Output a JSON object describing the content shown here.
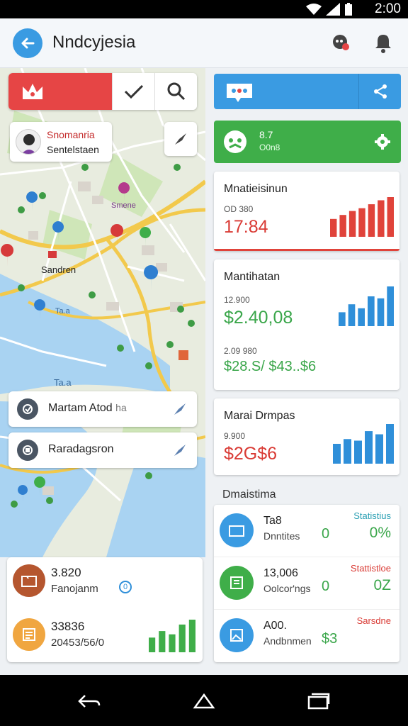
{
  "status_bar": {
    "time": "2:00"
  },
  "app_bar": {
    "title": "Nndcyjesia"
  },
  "map": {
    "place_card": {
      "title": "Snomanria",
      "subtitle": "Sentelstaen"
    },
    "labels": [
      "Sandren",
      "Ta.a"
    ],
    "poi_label": "Smene",
    "routes": [
      {
        "label": "Martam Atod",
        "suffix": "ha"
      },
      {
        "label": "Raradagsron",
        "suffix": ""
      }
    ]
  },
  "bottom_card": {
    "rows": [
      {
        "value": "3.820",
        "sub": "Fanojanm",
        "badge": "0",
        "icon": "folder-icon",
        "color": "#b5562f"
      },
      {
        "value": "33836",
        "sub": "20453/56/0",
        "badge": "",
        "icon": "note-icon",
        "color": "#f0a640"
      }
    ]
  },
  "right": {
    "green_card": {
      "line1": "8.7",
      "line2": "O0n8"
    },
    "stat_cards": [
      {
        "title": "Mnatieisinun",
        "small": "OD 380",
        "big": "17:84",
        "big_color": "#d93a34",
        "bar_color": "#e0433a",
        "bars": [
          0.45,
          0.55,
          0.65,
          0.72,
          0.82,
          0.92,
          1.0
        ]
      },
      {
        "title": "Mantihatan",
        "small": "12.900",
        "big": "$2.40,08",
        "big_color": "#3aa64a",
        "small2": "2.09 980",
        "big2": "$28.S/ $43..$6",
        "bar_color": "#2f8fd9",
        "bars": [
          0.35,
          0.55,
          0.45,
          0.75,
          0.7,
          1.0
        ]
      },
      {
        "title": "Marai Drmpas",
        "small": "9.900",
        "big": "$2G$6",
        "big_color": "#d93a34",
        "bar_color": "#2f8fd9",
        "bars": [
          0.5,
          0.62,
          0.58,
          0.82,
          0.74,
          1.0
        ]
      }
    ],
    "section_label": "Dmaistima",
    "list": [
      {
        "value": "Ta8",
        "sub": "Dnntites",
        "n1": "0",
        "tag": "Statistius",
        "n2": "0%",
        "tag_color": "#2a9fb3",
        "num_color": "#3aa64a",
        "icon": "folder-icon",
        "color": "#3a9be2"
      },
      {
        "value": "13,006",
        "sub": "Oolcor'ngs",
        "n1": "0",
        "tag": "Stattistloe",
        "n2": "0Z",
        "tag_color": "#d93a34",
        "num_color": "#3aa64a",
        "icon": "document-icon",
        "color": "#3fae49"
      },
      {
        "value": "A00.",
        "sub": "Andbnmen",
        "n1": "$3",
        "tag": "Sarsdne",
        "n2": "",
        "tag_color": "#d93a34",
        "num_color": "#3aa64a",
        "icon": "image-icon",
        "color": "#3a9be2"
      }
    ]
  },
  "colors": {
    "primary_blue": "#3a9be2",
    "accent_red": "#e64545",
    "accent_green": "#3fae49"
  }
}
